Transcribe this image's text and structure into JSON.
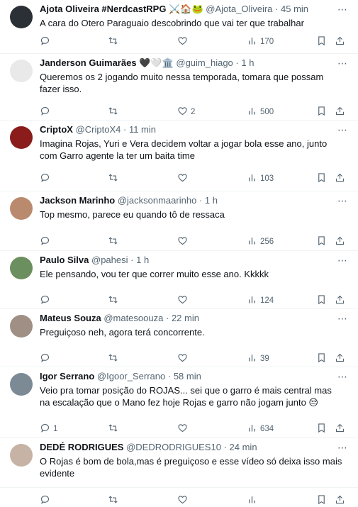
{
  "tweets": [
    {
      "name": "Ajota Oliveira #NerdcastRPG",
      "emoji": "⚔️🏠🐸",
      "handle": "@Ajota_Oliveira",
      "time": "45 min",
      "text": "A cara do Otero Paraguaio descobrindo que vai ter que trabalhar",
      "replies": "",
      "retweets": "",
      "likes": "",
      "views": "170",
      "avatar_color": "#2b2f36"
    },
    {
      "name": "Janderson Guimarães",
      "emoji": "🖤🤍🏛️",
      "handle": "@guim_hiago",
      "time": "1 h",
      "text": "Queremos os 2 jogando muito nessa temporada,  tomara que possam fazer isso.",
      "replies": "",
      "retweets": "",
      "likes": "2",
      "views": "500",
      "avatar_color": "#e9e9e9"
    },
    {
      "name": "CriptoX",
      "emoji": "",
      "handle": "@CriptoX4",
      "time": "11 min",
      "text": "Imagina Rojas, Yuri e Vera decidem voltar a jogar bola esse ano, junto com Garro agente la ter um baita time",
      "replies": "",
      "retweets": "",
      "likes": "",
      "views": "103",
      "avatar_color": "#8a1c1c"
    },
    {
      "name": "Jackson Marinho",
      "emoji": "",
      "handle": "@jacksonmaarinho",
      "time": "1 h",
      "text": "Top mesmo, parece eu quando tô de ressaca",
      "replies": "",
      "retweets": "",
      "likes": "",
      "views": "256",
      "avatar_color": "#b98a6e"
    },
    {
      "name": "Paulo Silva",
      "emoji": "",
      "handle": "@pahesi",
      "time": "1 h",
      "text": "Ele pensando, vou ter que correr muito esse ano. Kkkkk",
      "replies": "",
      "retweets": "",
      "likes": "",
      "views": "124",
      "avatar_color": "#6b8f5e"
    },
    {
      "name": "Mateus Souza",
      "emoji": "",
      "handle": "@matesoouza",
      "time": "22 min",
      "text": "Preguiçoso neh, agora terá concorrente.",
      "replies": "",
      "retweets": "",
      "likes": "",
      "views": "39",
      "avatar_color": "#a08f84"
    },
    {
      "name": "Igor Serrano",
      "emoji": "",
      "handle": "@Igoor_Serrano",
      "time": "58 min",
      "text": "Veio pra tomar posição do ROJAS... sei que o garro é mais central mas na escalação que o Mano fez hoje Rojas e garro não jogam junto 😒",
      "replies": "1",
      "retweets": "",
      "likes": "",
      "views": "634",
      "avatar_color": "#7c8a96"
    },
    {
      "name": "DEDÉ RODRIGUES",
      "emoji": "",
      "handle": "@DEDRODRIGUES10",
      "time": "24 min",
      "text": "O Rojas é bom de bola,mas é preguiçoso e esse vídeo só deixa isso mais evidente",
      "replies": "",
      "retweets": "",
      "likes": "",
      "views": "",
      "avatar_color": "#c7b3a5"
    }
  ]
}
